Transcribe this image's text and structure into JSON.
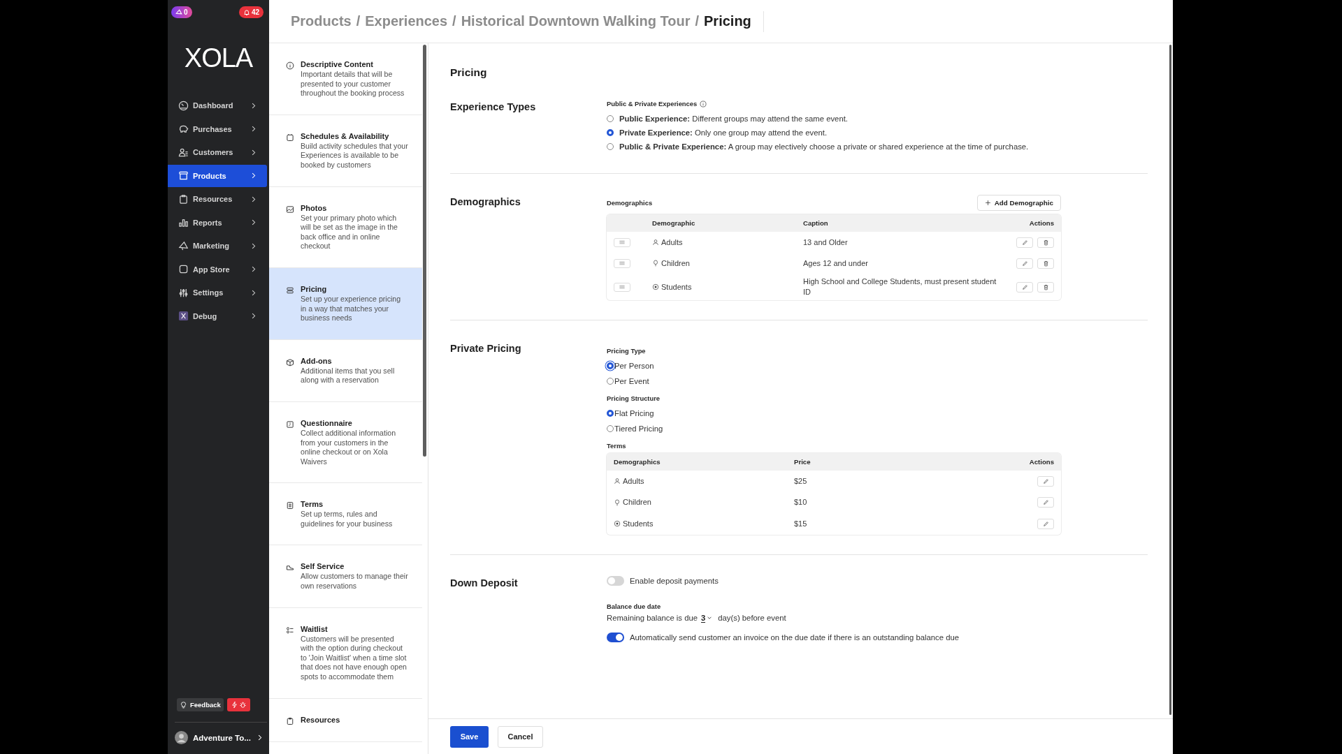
{
  "badges": [
    {
      "kind": "promo",
      "text": "0"
    },
    {
      "kind": "alerts",
      "text": "42"
    }
  ],
  "logo": "XOLA",
  "nav": [
    {
      "label": "Dashboard",
      "selected": false
    },
    {
      "label": "Purchases",
      "selected": false
    },
    {
      "label": "Customers",
      "selected": false
    },
    {
      "label": "Products",
      "selected": true
    },
    {
      "label": "Resources",
      "selected": false
    },
    {
      "label": "Reports",
      "selected": false
    },
    {
      "label": "Marketing",
      "selected": false
    },
    {
      "label": "App Store",
      "selected": false
    },
    {
      "label": "Settings",
      "selected": false
    },
    {
      "label": "Debug",
      "selected": false
    }
  ],
  "feedback_button": "Feedback",
  "account": "Adventure To...",
  "breadcrumb": [
    {
      "kind": "link",
      "text": "Products"
    },
    {
      "kind": "separator",
      "text": "/"
    },
    {
      "kind": "link",
      "text": "Experiences"
    },
    {
      "kind": "separator",
      "text": "/"
    },
    {
      "kind": "link",
      "text": "Historical Downtown Walking Tour"
    },
    {
      "kind": "separator",
      "text": "/"
    },
    {
      "kind": "current",
      "text": "Pricing"
    }
  ],
  "steps": [
    {
      "title": "Descriptive Content",
      "description": "Important details that will be presented to your customer throughout the booking process",
      "selected": false
    },
    {
      "title": "Schedules & Availability",
      "description": "Build activity schedules that your Experiences is available to be booked by customers",
      "selected": false
    },
    {
      "title": "Photos",
      "description": "Set your primary photo which will be set as the image in the back office and in online checkout",
      "selected": false
    },
    {
      "title": "Pricing",
      "description": "Set up your experience pricing in a way that matches your business needs",
      "selected": true
    },
    {
      "title": "Add-ons",
      "description": "Additional items that you sell along with a reservation",
      "selected": false
    },
    {
      "title": "Questionnaire",
      "description": "Collect additional information from your customers in the online checkout or on Xola Waivers",
      "selected": false
    },
    {
      "title": "Terms",
      "description": "Set up terms, rules and guidelines for your business",
      "selected": false
    },
    {
      "title": "Self Service",
      "description": "Allow customers to manage their own reservations",
      "selected": false
    },
    {
      "title": "Waitlist",
      "description": "Customers will be presented with the option during checkout to 'Join Waitlist' when a time slot that does not have enough open spots to accommodate them",
      "selected": false
    },
    {
      "title": "Resources",
      "selected": false
    }
  ],
  "page_title": "Pricing",
  "experience_types": {
    "heading": "Experience Types",
    "label": "Public & Private Experiences",
    "options": [
      {
        "text": "**Public Experience:** Different groups may attend the same event.",
        "selected": false
      },
      {
        "text": "**Private Experience:** Only one group may attend the event.",
        "selected": true
      },
      {
        "text": "**Public & Private Experience:** A group may electively choose a private or shared experience at the time of purchase.",
        "selected": false
      }
    ]
  },
  "demographics": {
    "heading": "Demographics",
    "label": "Demographics",
    "add_button": "Add Demographic",
    "columns": [
      "Demographic",
      "Caption",
      "Actions"
    ],
    "rows": [
      {
        "name": "Adults",
        "caption": "13 and Older"
      },
      {
        "name": "Children",
        "caption": "Ages 12 and under"
      },
      {
        "name": "Students",
        "caption": "High School and College Students, must present student ID"
      }
    ]
  },
  "private_pricing": {
    "heading": "Private Pricing",
    "groups": [
      {
        "label": "Pricing Type",
        "options": [
          {
            "text": "Per Person",
            "selected": true
          },
          {
            "text": "Per Event",
            "selected": false
          }
        ]
      },
      {
        "label": "Pricing Structure",
        "options": [
          {
            "text": "Flat Pricing",
            "selected": true
          },
          {
            "text": "Tiered Pricing",
            "selected": false
          }
        ]
      }
    ],
    "terms": {
      "label": "Terms",
      "columns": [
        "Demographics",
        "Price",
        "Actions"
      ],
      "rows": [
        {
          "name": "Adults",
          "price": "$25"
        },
        {
          "name": "Children",
          "price": "$10"
        },
        {
          "name": "Students",
          "price": "$15"
        }
      ]
    }
  },
  "down_deposit": {
    "heading": "Down Deposit",
    "enable": {
      "label": "Enable deposit payments",
      "on": false
    },
    "balance_label": "Balance due date",
    "balance_prefix": "Remaining balance is due",
    "days": "3",
    "balance_suffix": "day(s) before event",
    "auto_invoice": {
      "label": "Automatically send customer an invoice on the due date if there is an outstanding balance due",
      "on": true
    }
  },
  "buttons": {
    "save": "Save",
    "cancel": "Cancel"
  }
}
